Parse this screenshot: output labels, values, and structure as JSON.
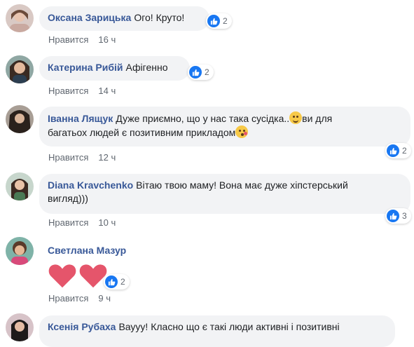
{
  "comments": [
    {
      "author": "Оксана Зарицька",
      "text": "Ого! Круто!",
      "reactions": "2",
      "like_label": "Нравится",
      "time": "16 ч"
    },
    {
      "author": "Катерина Рибій",
      "text": "Афігенно",
      "reactions": "2",
      "like_label": "Нравится",
      "time": "14 ч"
    },
    {
      "author": "Іванна Лящук",
      "text_line1": "Дуже приємно, що у нас така сусідка..",
      "text_line1_after": "ви для",
      "text_line2": "багатьох людей є позитивним прикладом",
      "reactions": "2",
      "like_label": "Нравится",
      "time": "12 ч"
    },
    {
      "author": "Diana Kravchenko",
      "text_line1": "Вітаю твою маму! Вона має дуже хіпстерський",
      "text_line2": "вигляд)))",
      "reactions": "3",
      "like_label": "Нравится",
      "time": "10 ч"
    },
    {
      "author": "Светлана Мазур",
      "reactions": "2",
      "like_label": "Нравится",
      "time": "9 ч"
    },
    {
      "author": "Ксенія Рубаха",
      "text": "Ваууу! Класно що є такі люди активні і позитивні"
    }
  ],
  "colors": {
    "author": "#385898",
    "bubble": "#f2f3f5",
    "like_blue": "#1877f2",
    "meta": "#606770",
    "heart": "#e5556b"
  },
  "icons": {
    "reaction": "like-thumb-icon",
    "emoji_hug": "hugging-face-icon",
    "emoji_kiss": "kissing-face-icon",
    "heart": "heart-icon"
  }
}
